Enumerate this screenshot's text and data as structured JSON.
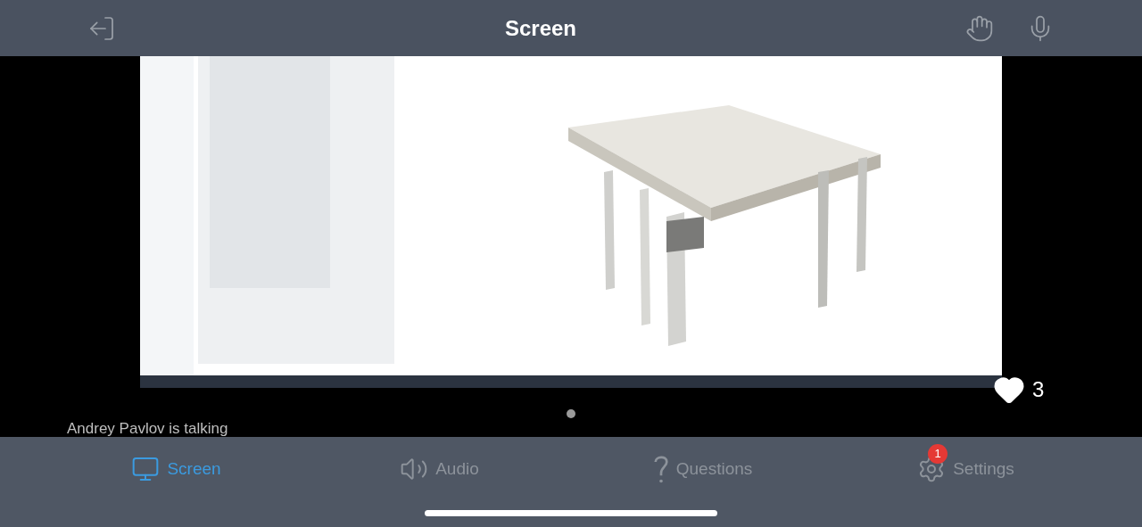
{
  "header": {
    "title": "Screen"
  },
  "stage": {
    "kind": "picture",
    "likes": "3",
    "speaker": "Andrey Pavlov is talking"
  },
  "tabs": [
    {
      "kind": "screen",
      "label": "Screen",
      "selected": true
    },
    {
      "kind": "audio",
      "label": "Audio",
      "selected": false
    },
    {
      "kind": "questions",
      "label": "Questions",
      "selected": false
    },
    {
      "kind": "settings",
      "label": "Settings",
      "selected": false,
      "badge": "1"
    }
  ]
}
